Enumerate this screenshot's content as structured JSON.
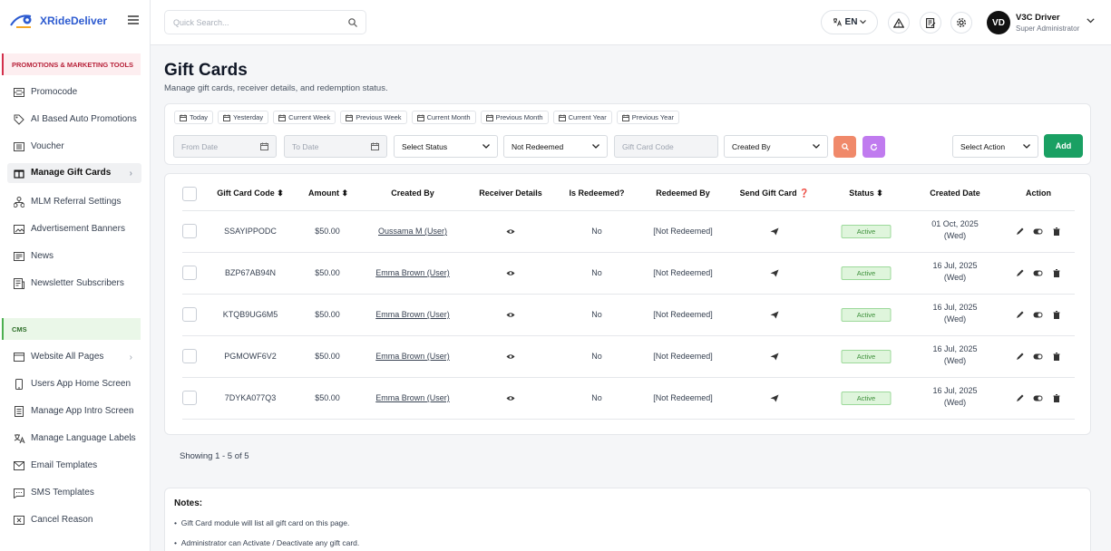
{
  "brand": {
    "name": "XRideDeliver"
  },
  "sidebar": {
    "promo_header": "PROMOTIONS & MARKETING TOOLS",
    "cms_header": "CMS",
    "promo_items": [
      {
        "label": "Promocode"
      },
      {
        "label": "AI Based Auto Promotions"
      },
      {
        "label": "Voucher"
      },
      {
        "label": "Manage Gift Cards",
        "active": true
      },
      {
        "label": "MLM Referral Settings"
      },
      {
        "label": "Advertisement Banners"
      },
      {
        "label": "News"
      },
      {
        "label": "Newsletter Subscribers"
      }
    ],
    "cms_items": [
      {
        "label": "Website All Pages"
      },
      {
        "label": "Users App Home Screen"
      },
      {
        "label": "Manage App Intro Screen"
      },
      {
        "label": "Manage Language Labels"
      },
      {
        "label": "Email Templates"
      },
      {
        "label": "SMS Templates"
      },
      {
        "label": "Cancel Reason"
      }
    ]
  },
  "topbar": {
    "search_placeholder": "Quick Search...",
    "language": "EN",
    "user": {
      "initials": "VD",
      "name": "V3C Driver",
      "role": "Super Administrator"
    }
  },
  "page": {
    "title": "Gift Cards",
    "subtitle": "Manage gift cards, receiver details, and redemption status."
  },
  "filters": {
    "periods": [
      "Today",
      "Yesterday",
      "Current Week",
      "Previous Week",
      "Current Month",
      "Previous Month",
      "Current Year",
      "Previous Year"
    ],
    "from_date_placeholder": "From Date",
    "to_date_placeholder": "To Date",
    "status_select": "Select Status",
    "redeemed_select": "Not Redeemed",
    "code_placeholder": "Gift Card Code",
    "created_by_select": "Created By",
    "action_select": "Select Action",
    "add_label": "Add"
  },
  "table": {
    "headers": {
      "code": "Gift Card Code",
      "amount": "Amount",
      "created_by": "Created By",
      "receiver": "Receiver Details",
      "redeemed": "Is Redeemed?",
      "redeemed_by": "Redeemed By",
      "send": "Send Gift Card",
      "status": "Status",
      "created_date": "Created Date",
      "action": "Action"
    },
    "rows": [
      {
        "code": "SSAYIPPODC",
        "amount": "$50.00",
        "created_by": "Oussama M (User)",
        "redeemed": "No",
        "redeemed_by": "[Not Redeemed]",
        "status": "Active",
        "date": "01 Oct, 2025",
        "day": "(Wed)"
      },
      {
        "code": "BZP67AB94N",
        "amount": "$50.00",
        "created_by": "Emma Brown (User)",
        "redeemed": "No",
        "redeemed_by": "[Not Redeemed]",
        "status": "Active",
        "date": "16 Jul, 2025",
        "day": "(Wed)"
      },
      {
        "code": "KTQB9UG6M5",
        "amount": "$50.00",
        "created_by": "Emma Brown (User)",
        "redeemed": "No",
        "redeemed_by": "[Not Redeemed]",
        "status": "Active",
        "date": "16 Jul, 2025",
        "day": "(Wed)"
      },
      {
        "code": "PGMOWF6V2",
        "amount": "$50.00",
        "created_by": "Emma Brown (User)",
        "redeemed": "No",
        "redeemed_by": "[Not Redeemed]",
        "status": "Active",
        "date": "16 Jul, 2025",
        "day": "(Wed)"
      },
      {
        "code": "7DYKA077Q3",
        "amount": "$50.00",
        "created_by": "Emma Brown (User)",
        "redeemed": "No",
        "redeemed_by": "[Not Redeemed]",
        "status": "Active",
        "date": "16 Jul, 2025",
        "day": "(Wed)"
      }
    ]
  },
  "pagination": {
    "showing": "Showing 1 - 5 of 5"
  },
  "notes": {
    "title": "Notes:",
    "items": [
      "Gift Card module will list all gift card on this page.",
      "Administrator can Activate / Deactivate any gift card."
    ]
  },
  "colors": {
    "brand": "#2d5bd0",
    "add": "#1aa063",
    "search_btn": "#f0896a",
    "reset_btn": "#c07bef",
    "active_badge": "#dff5dc"
  }
}
